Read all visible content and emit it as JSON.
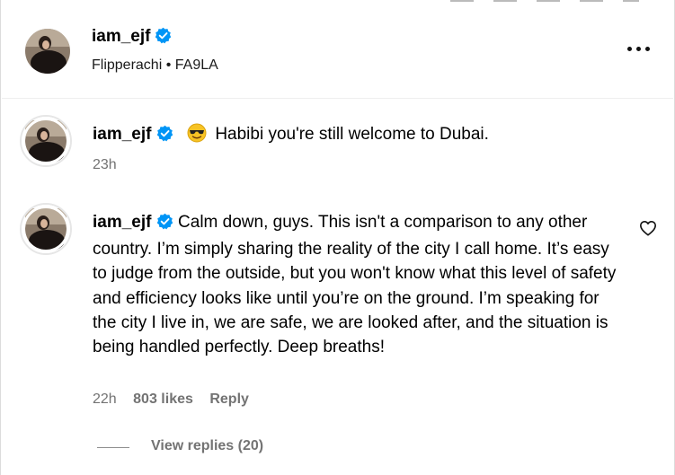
{
  "post": {
    "username": "iam_ejf",
    "audio_artist": "Flipperachi",
    "audio_separator": "•",
    "audio_track": "FA9LA"
  },
  "comments": [
    {
      "username": "iam_ejf",
      "emoji": "smiling-face-with-sunglasses",
      "text": "Habibi you're still welcome to Dubai.",
      "time": "23h"
    },
    {
      "username": "iam_ejf",
      "text": "Calm down, guys. This isn't a comparison to any other country. I’m simply sharing the reality of the city I call home. It’s easy to judge from the outside, but you won't know what this level of safety and efficiency looks like until you’re on the ground. I’m speaking for the city I live in, we are safe, we are looked after, and the situation is being handled perfectly. Deep breaths!",
      "time": "22h",
      "likes": "803 likes",
      "reply_label": "Reply",
      "view_replies": "View replies (20)"
    }
  ],
  "icons": {
    "verified": "verified-badge-icon",
    "more": "more-options-icon",
    "like": "heart-outline-icon"
  },
  "colors": {
    "verified_blue": "#0095f6",
    "secondary_text": "#737373"
  }
}
